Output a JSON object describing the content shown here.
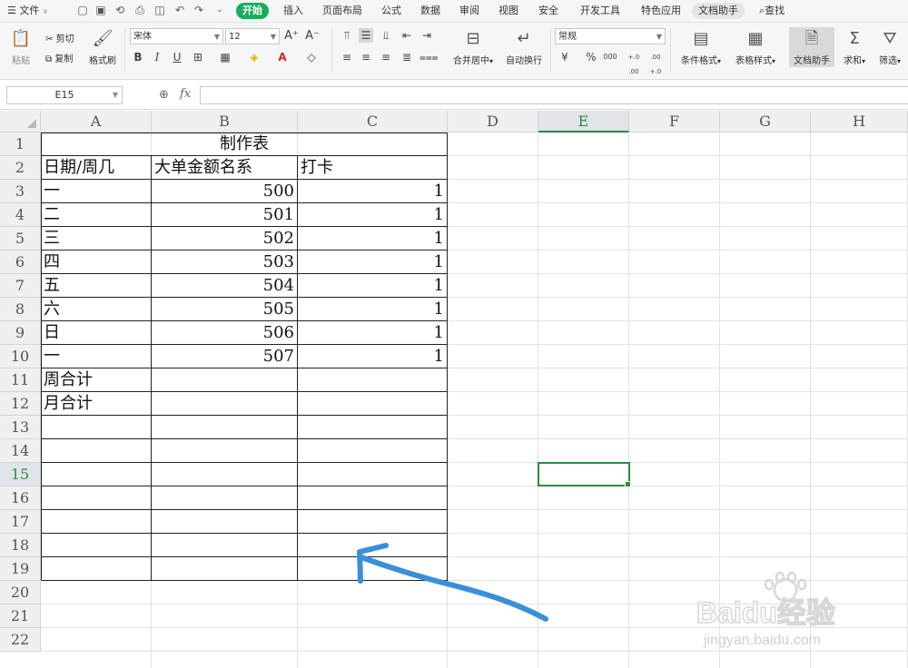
{
  "menu": {
    "file": "文件",
    "tabs": [
      "开始",
      "插入",
      "页面布局",
      "公式",
      "数据",
      "审阅",
      "视图",
      "安全",
      "开发工具",
      "特色应用",
      "文档助手"
    ],
    "search": "查找"
  },
  "ribbon": {
    "paste": "粘贴",
    "cut": "剪切",
    "copy": "复制",
    "format_painter": "格式刷",
    "font_name": "宋体",
    "font_size": "12",
    "number_format": "常规",
    "merge_center": "合并居中",
    "wrap_text": "自动换行",
    "conditional_format": "条件格式",
    "table_style": "表格样式",
    "doc_helper": "文档助手",
    "sum": "求和",
    "filter": "筛选",
    "bold": "B",
    "italic": "I",
    "underline": "U",
    "percent": "%",
    "thousands": "000",
    "inc_decimal": "+.0 .00",
    "dec_decimal": ".00 +.0"
  },
  "formula_bar": {
    "name_box": "E15",
    "fx": "fx",
    "value": ""
  },
  "columns": [
    "A",
    "B",
    "C",
    "D",
    "E",
    "F",
    "G",
    "H"
  ],
  "rows": [
    "1",
    "2",
    "3",
    "4",
    "5",
    "6",
    "7",
    "8",
    "9",
    "10",
    "11",
    "12",
    "13",
    "14",
    "15",
    "16",
    "17",
    "18",
    "19",
    "20",
    "21",
    "22"
  ],
  "selected_cell": "E15",
  "sheet": {
    "title": "制作表",
    "headers": [
      "日期/周几",
      "大单金额名系",
      "打卡"
    ],
    "data_rows": [
      [
        "一",
        "500",
        "1"
      ],
      [
        "二",
        "501",
        "1"
      ],
      [
        "三",
        "502",
        "1"
      ],
      [
        "四",
        "503",
        "1"
      ],
      [
        "五",
        "504",
        "1"
      ],
      [
        "六",
        "505",
        "1"
      ],
      [
        "日",
        "506",
        "1"
      ],
      [
        "一",
        "507",
        "1"
      ]
    ],
    "week_total": "周合计",
    "month_total": "月合计"
  },
  "annotation_color": "#3a8fd9",
  "accent_color": "#1aac5e",
  "watermark": {
    "brand": "Baidu经验",
    "url": "jingyan.baidu.com"
  }
}
